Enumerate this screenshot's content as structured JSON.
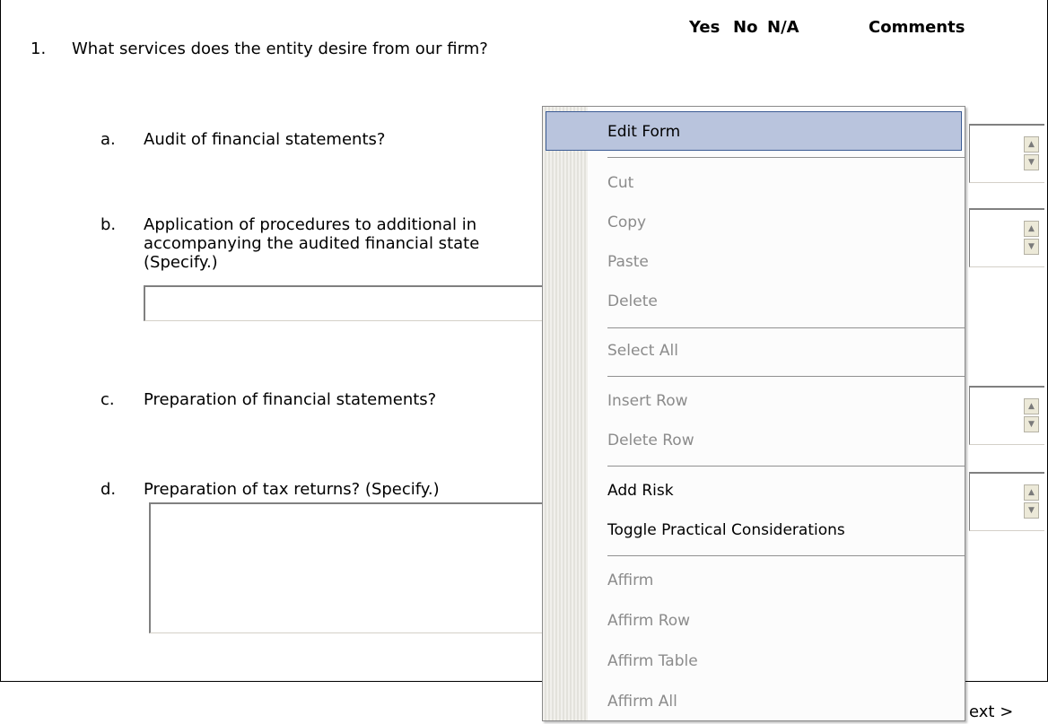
{
  "header": {
    "yes": "Yes",
    "no": "No",
    "na": "N/A",
    "comments": "Comments"
  },
  "question": {
    "number": "1.",
    "text": "What services does the entity desire from our firm?"
  },
  "items": [
    {
      "letter": "a.",
      "line1": "Audit of financial statements?"
    },
    {
      "letter": "b.",
      "line1": "Application of procedures to additional in",
      "line2": "accompanying the audited financial state",
      "line3": "(Specify.)"
    },
    {
      "letter": "c.",
      "line1": "Preparation of financial statements?"
    },
    {
      "letter": "d.",
      "line1": "Preparation of tax returns? (Specify.)"
    }
  ],
  "context_menu": {
    "edit_form": "Edit Form",
    "cut": "Cut",
    "copy": "Copy",
    "paste": "Paste",
    "delete": "Delete",
    "select_all": "Select All",
    "insert_row": "Insert Row",
    "delete_row": "Delete Row",
    "add_risk": "Add Risk",
    "toggle_practical": "Toggle Practical Considerations",
    "affirm": "Affirm",
    "affirm_row": "Affirm Row",
    "affirm_table": "Affirm Table",
    "affirm_all": "Affirm All"
  },
  "footer": {
    "next_partial": "ext >"
  },
  "colors": {
    "highlight": "#b9c4dd",
    "highlight_border": "#3a5a93",
    "disabled_text": "#8b8b8b"
  }
}
